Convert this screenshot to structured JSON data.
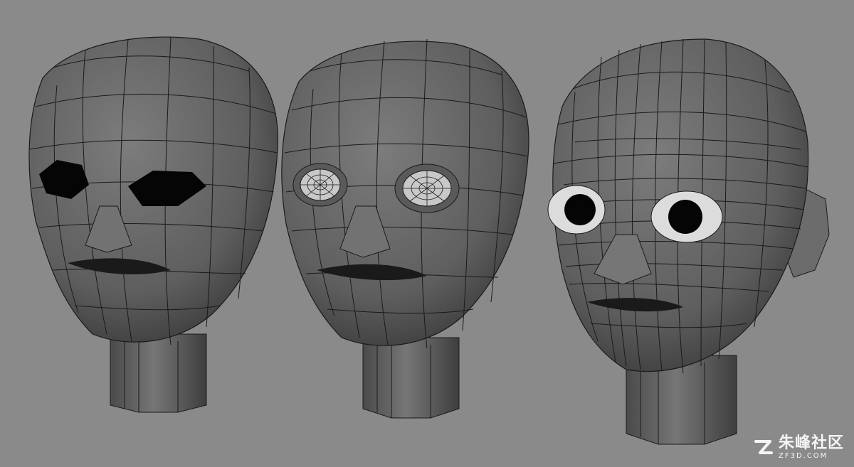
{
  "scene": {
    "background_color": "#8a8a8a",
    "head_fill": "#6a6a6a",
    "wire_color": "#1a1a1a",
    "eye_hole_color": "#050505",
    "iris_color": "#dcdcdc",
    "heads": [
      {
        "name": "head-1-blocked-eyes"
      },
      {
        "name": "head-2-radial-eyes"
      },
      {
        "name": "head-3-detailed-with-ear"
      }
    ]
  },
  "watermark": {
    "logo_icon": "zf-logo-icon",
    "name": "朱峰社区",
    "domain": "ZF3D.COM"
  }
}
